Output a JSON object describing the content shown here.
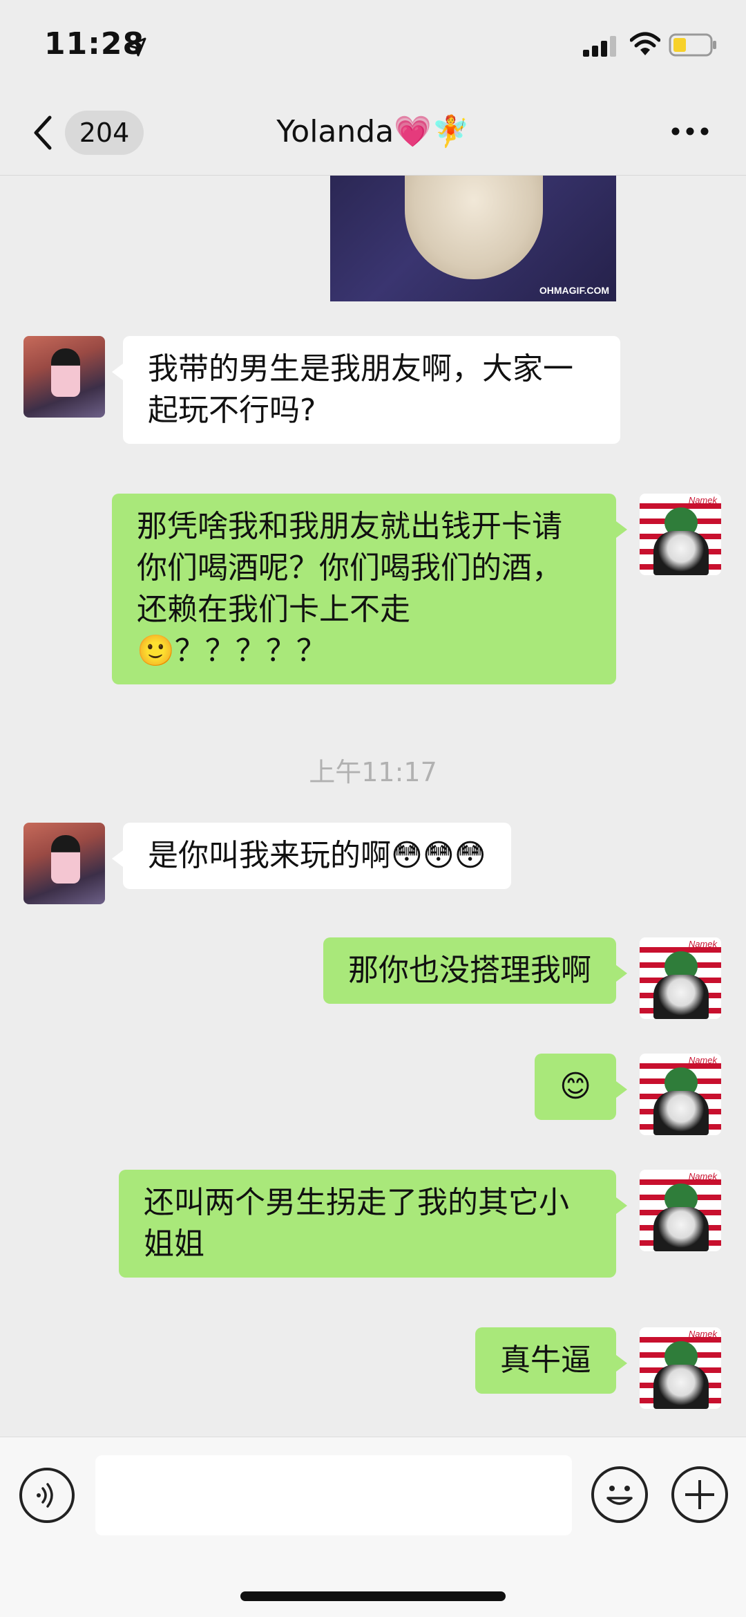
{
  "status_bar": {
    "time": "11:28",
    "icons": [
      "location-arrow-icon",
      "cellular-signal-icon",
      "wifi-icon",
      "battery-low-icon"
    ]
  },
  "nav": {
    "back_icon": "chevron-left-icon",
    "unread_count": "204",
    "title": "Yolanda💗🧚",
    "more_icon": "ellipsis-icon"
  },
  "messages": [
    {
      "id": "gif",
      "from": "self",
      "type": "image",
      "watermark": "OHMAGIF.COM"
    },
    {
      "id": "m1",
      "from": "other",
      "text": "我带的男生是我朋友啊，大家一起玩不行吗?"
    },
    {
      "id": "m2",
      "from": "self",
      "text": "那凭啥我和我朋友就出钱开卡请你们喝酒呢？你们喝我们的酒，还赖在我们卡上不走🙂？？？？？"
    },
    {
      "id": "ts",
      "type": "timestamp",
      "text": "上午11:17"
    },
    {
      "id": "m3",
      "from": "other",
      "text": "是你叫我来玩的啊😳😳😳"
    },
    {
      "id": "m4",
      "from": "self",
      "text": "那你也没搭理我啊"
    },
    {
      "id": "m5",
      "from": "self",
      "text": "😊"
    },
    {
      "id": "m6",
      "from": "self",
      "text": "还叫两个男生拐走了我的其它小姐姐"
    },
    {
      "id": "m7",
      "from": "self",
      "text": "真牛逼"
    }
  ],
  "input_bar": {
    "voice_icon": "voice-icon",
    "emoji_icon": "emoji-icon",
    "plus_icon": "plus-icon",
    "placeholder": ""
  },
  "colors": {
    "background": "#ededed",
    "self_bubble": "#a9e87a",
    "other_bubble": "#ffffff",
    "timestamp_text": "#b1b1b1"
  }
}
